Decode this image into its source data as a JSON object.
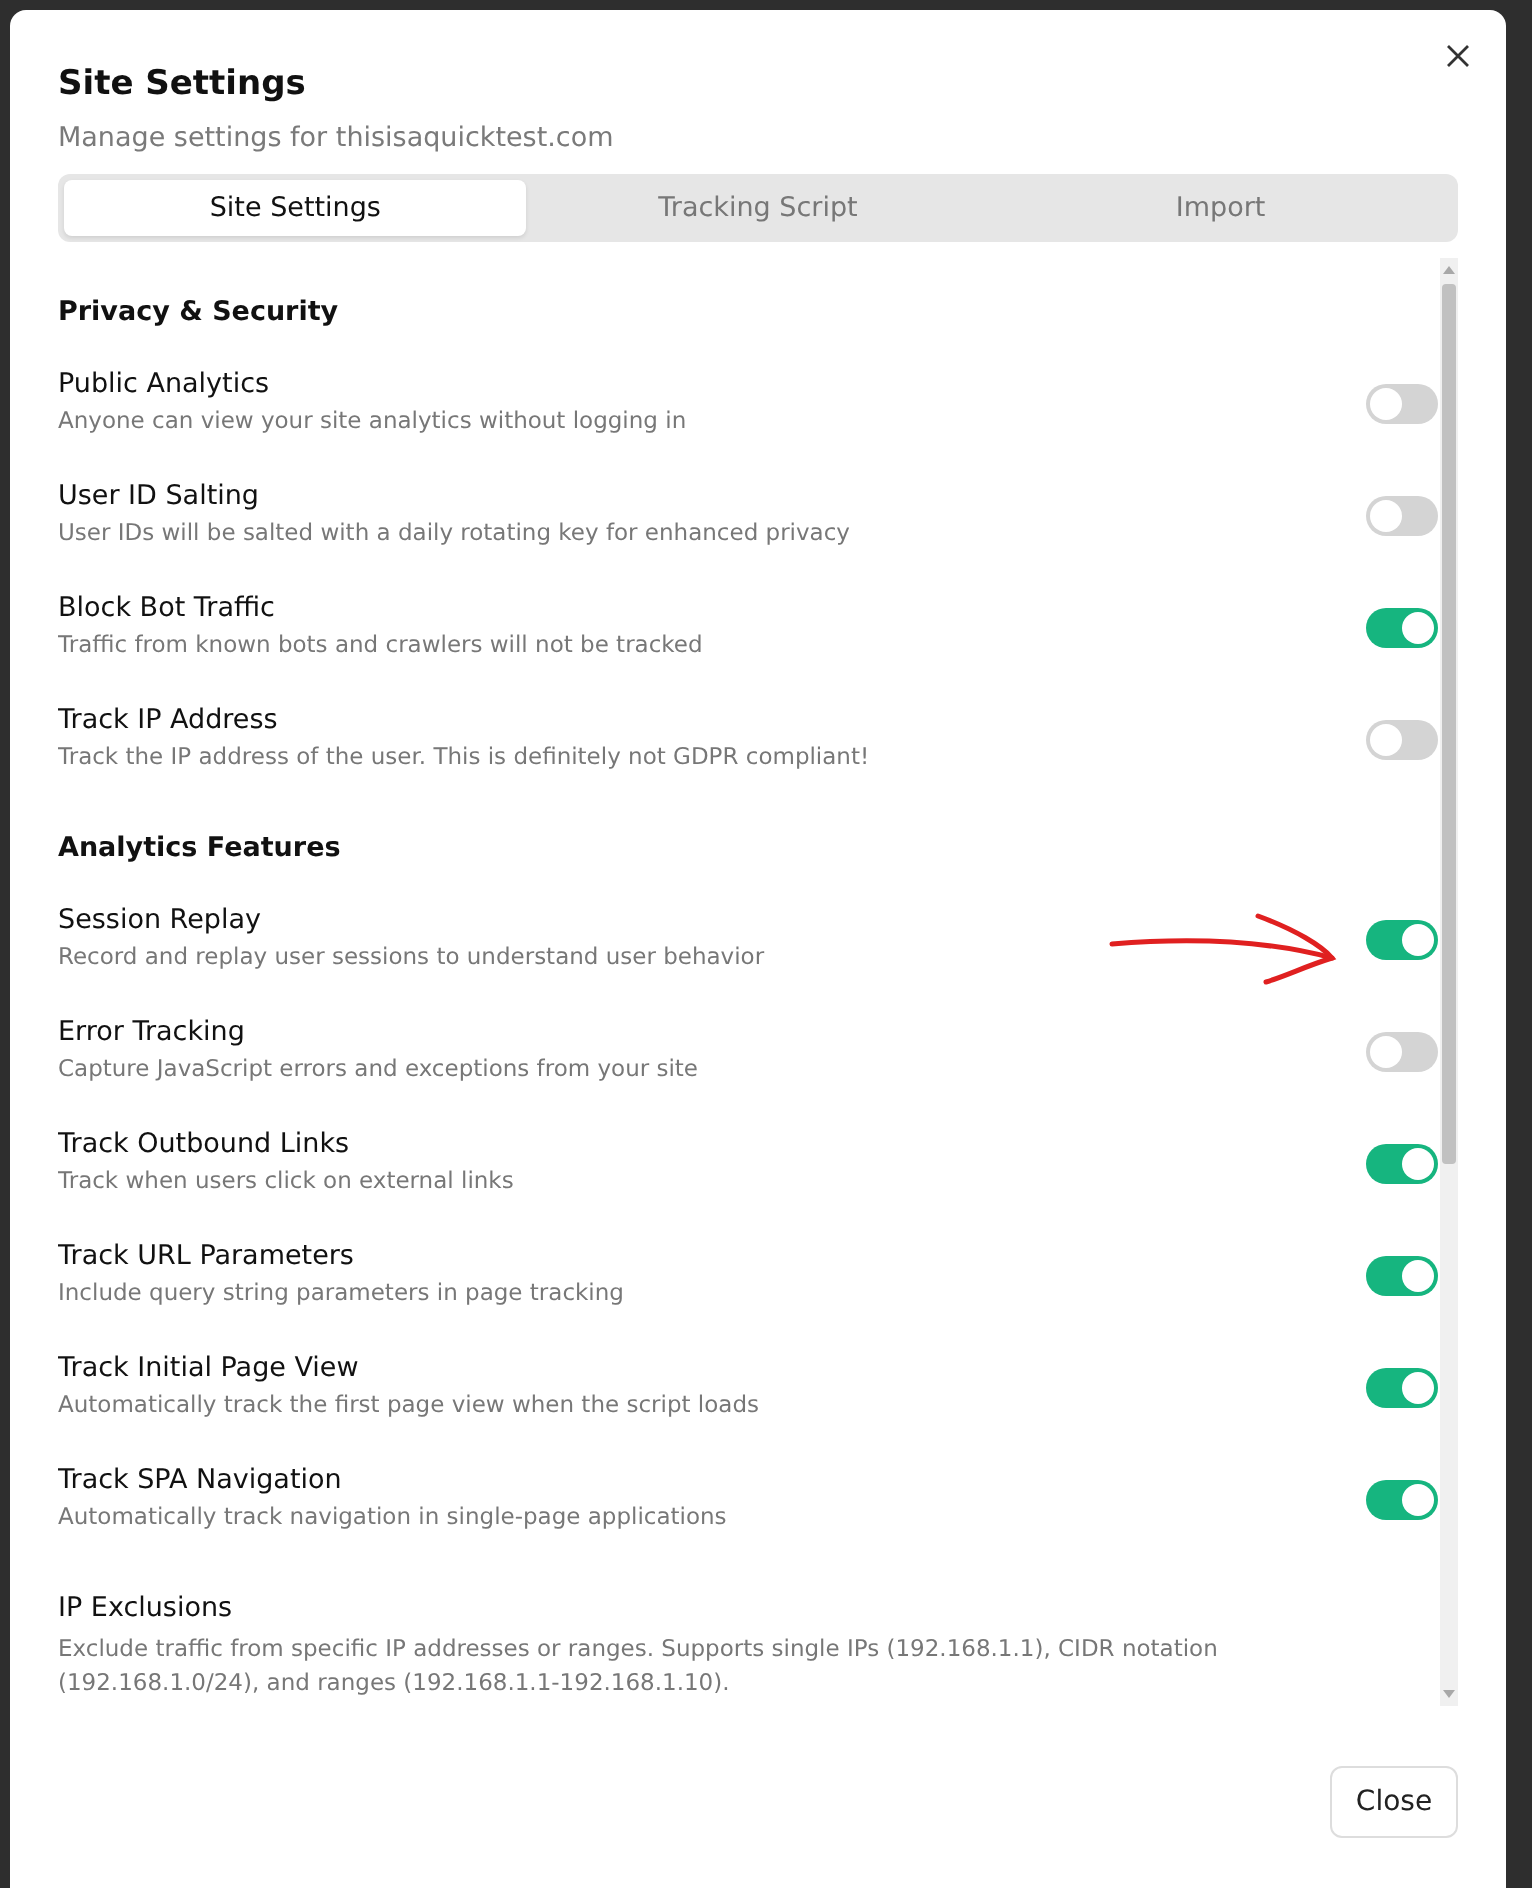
{
  "dialog": {
    "title": "Site Settings",
    "subtitle": "Manage settings for thisisaquicktest.com"
  },
  "tabs": [
    {
      "label": "Site Settings",
      "selected": true
    },
    {
      "label": "Tracking Script",
      "selected": false
    },
    {
      "label": "Import",
      "selected": false
    }
  ],
  "sections": [
    {
      "kind": "group",
      "title": "Privacy & Security",
      "items": [
        {
          "label": "Public Analytics",
          "description": "Anyone can view your site analytics without logging in",
          "on": false
        },
        {
          "label": "User ID Salting",
          "description": "User IDs will be salted with a daily rotating key for enhanced privacy",
          "on": false
        },
        {
          "label": "Block Bot Traffic",
          "description": "Traffic from known bots and crawlers will not be tracked",
          "on": true
        },
        {
          "label": "Track IP Address",
          "description": "Track the IP address of the user. This is definitely not GDPR compliant!",
          "on": false
        }
      ]
    },
    {
      "kind": "group",
      "title": "Analytics Features",
      "items": [
        {
          "label": "Session Replay",
          "description": "Record and replay user sessions to understand user behavior",
          "on": true
        },
        {
          "label": "Error Tracking",
          "description": "Capture JavaScript errors and exceptions from your site",
          "on": false
        },
        {
          "label": "Track Outbound Links",
          "description": "Track when users click on external links",
          "on": true
        },
        {
          "label": "Track URL Parameters",
          "description": "Include query string parameters in page tracking",
          "on": true
        },
        {
          "label": "Track Initial Page View",
          "description": "Automatically track the first page view when the script loads",
          "on": true
        },
        {
          "label": "Track SPA Navigation",
          "description": "Automatically track navigation in single-page applications",
          "on": true
        }
      ]
    },
    {
      "kind": "note",
      "title": "IP Exclusions",
      "description": "Exclude traffic from specific IP addresses or ranges. Supports single IPs (192.168.1.1), CIDR notation (192.168.1.0/24), and ranges (192.168.1.1-192.168.1.10)."
    }
  ],
  "footer": {
    "close_button": "Close"
  }
}
